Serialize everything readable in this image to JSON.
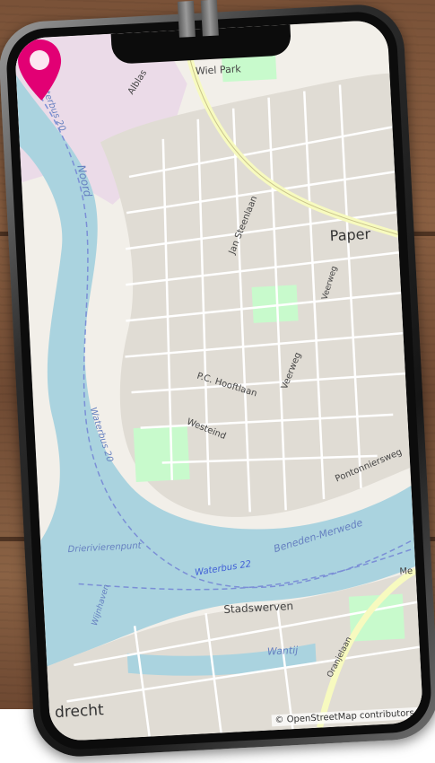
{
  "map": {
    "labels": {
      "wiel_park": "Wiel Park",
      "alblas": "Alblas",
      "waterbus_20_top": "Waterbus 20",
      "noord": "Noord",
      "jan_steenlaan": "Jan Steenlaan",
      "paper": "Paper",
      "veerweg_top": "Veerweg",
      "pc_hooftlaan": "P.C. Hooftlaan",
      "veerweg": "Veerweg",
      "westeind": "Westeind",
      "waterbus_20_mid": "Waterbus 20",
      "pontonniersweg": "Pontonniersweg",
      "drierivierenpunt": "Drierivierenpunt",
      "beneden_merwede": "Beneden-Merwede",
      "waterbus_22": "Waterbus 22",
      "stadswerven": "Stadswerven",
      "wantij": "Wantij",
      "oranjelaan": "Oranjelaan",
      "dordrecht": "drecht",
      "merwede_right": "Me",
      "wijnhaven": "Wijnhaven"
    },
    "attribution": "© OpenStreetMap contributors",
    "colors": {
      "water": "#aad3df",
      "land": "#f2efe9",
      "urban": "#e0dcd4",
      "park": "#c8facc",
      "industrial": "#ebdbe8",
      "major_road": "#f7fabf",
      "pin": "#e20074"
    },
    "pin_icon": "location-pin-icon"
  }
}
